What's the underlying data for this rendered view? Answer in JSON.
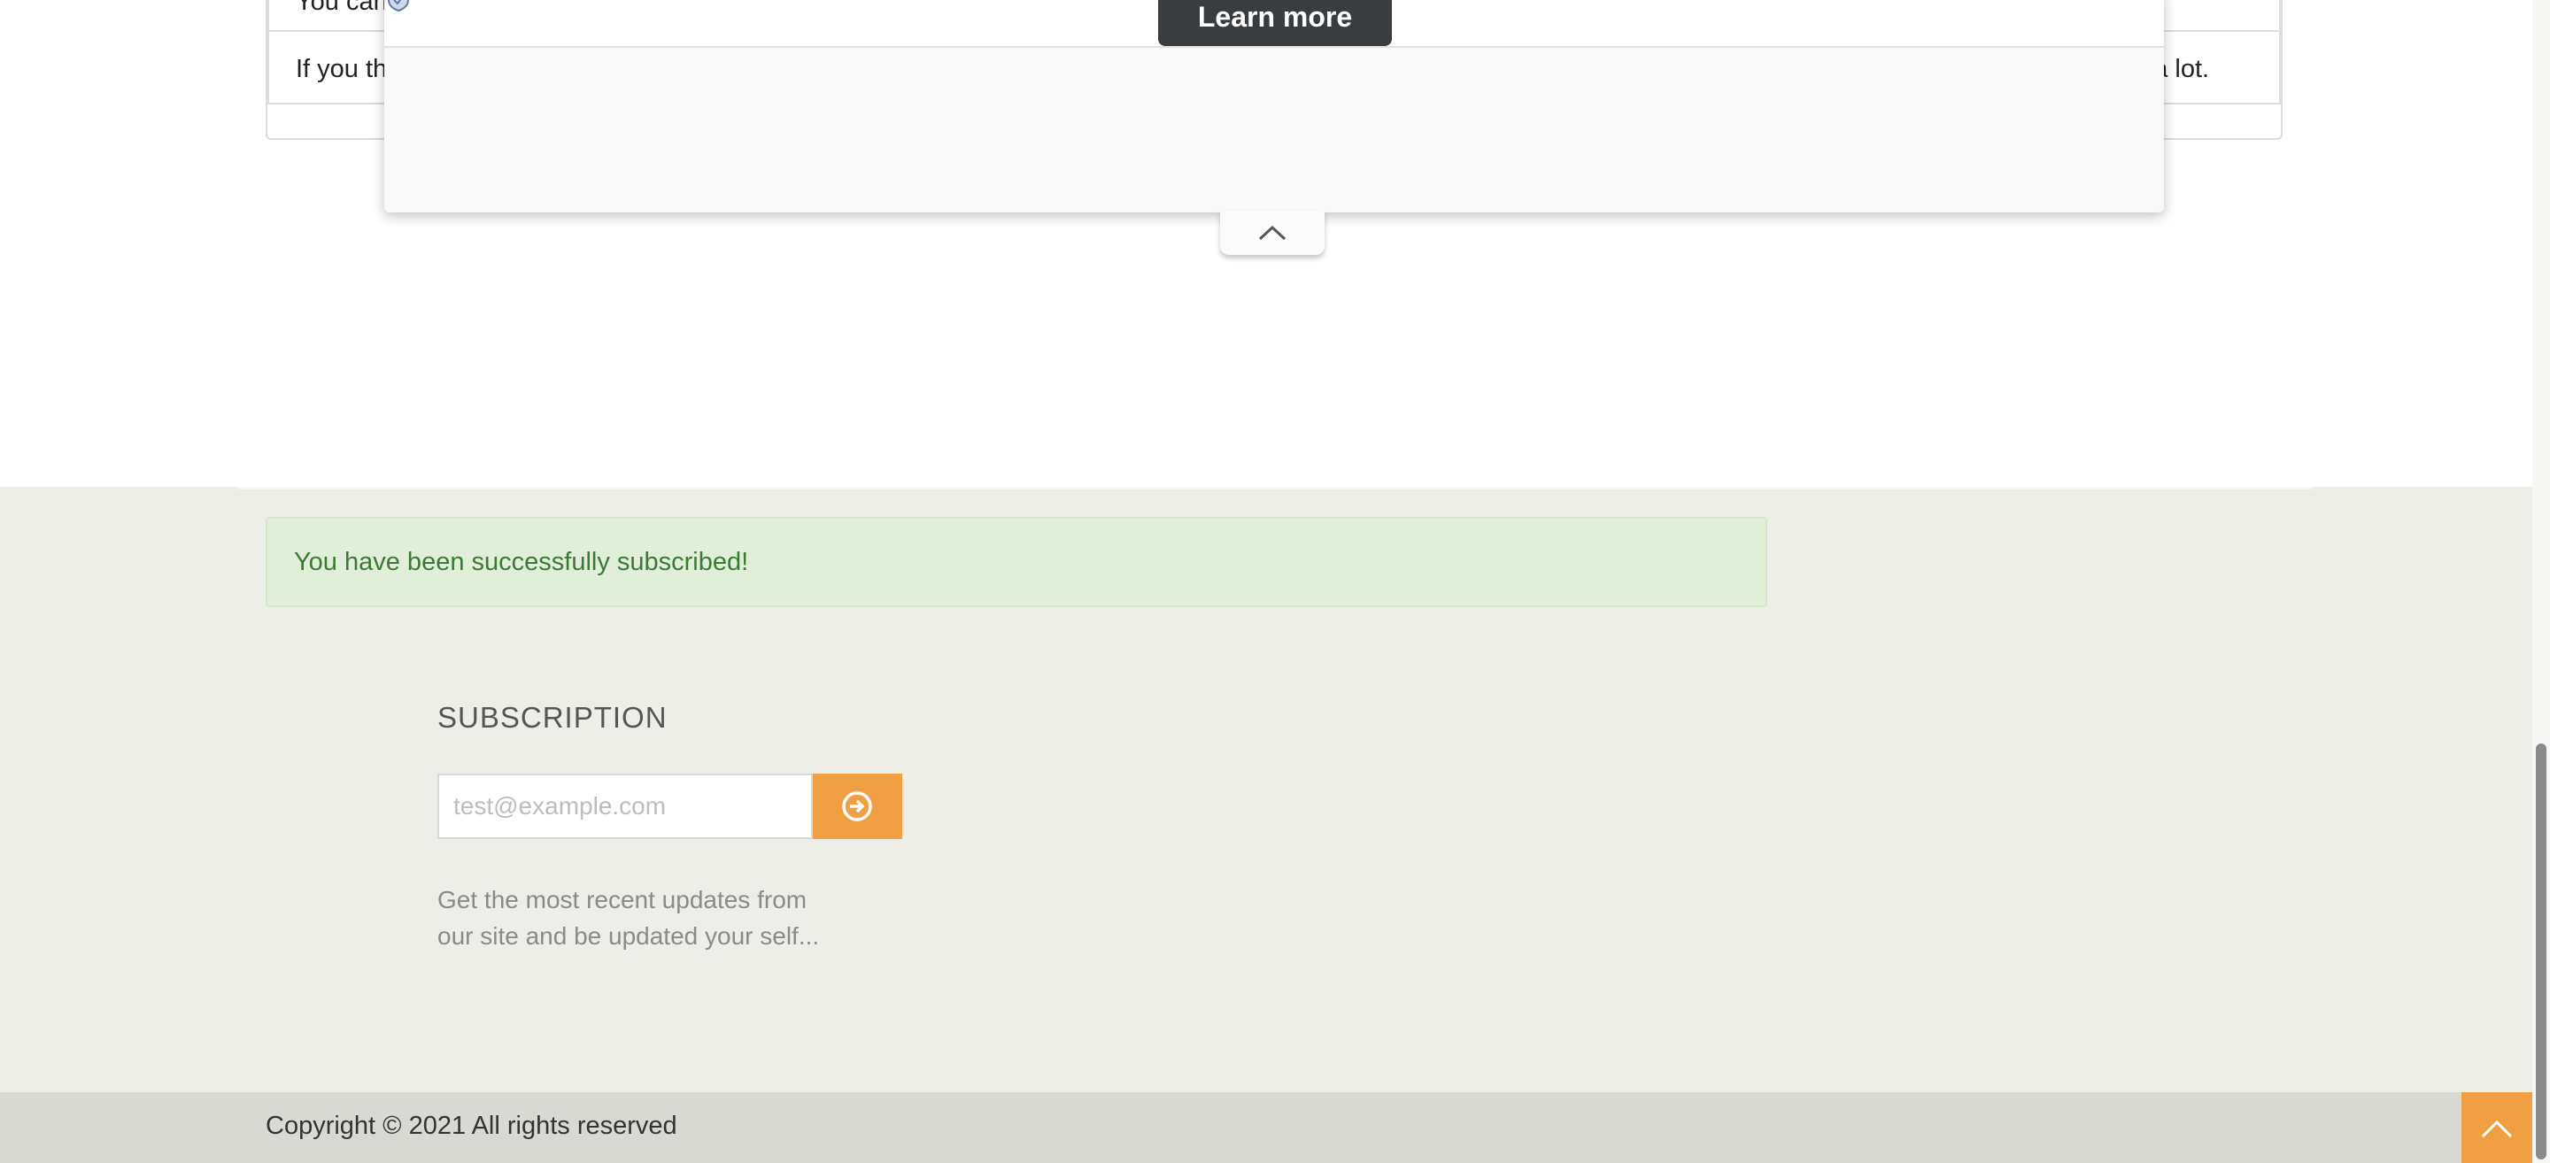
{
  "content_panel": {
    "row1_text": "You can",
    "row2_text_left": "If you th",
    "row2_text_right": "rs a lot."
  },
  "overlay": {
    "learn_more_label": "Learn more",
    "shield_icon": "shield-icon",
    "collapse_icon": "chevron-up-icon"
  },
  "alert": {
    "message": "You have been successfully subscribed!",
    "color": "#3c7a34",
    "background": "#e1efda"
  },
  "subscription": {
    "heading": "SUBSCRIPTION",
    "email_placeholder": "test@example.com",
    "email_value": "",
    "submit_icon": "arrow-circle-right-icon",
    "description_line1": "Get the most recent updates from",
    "description_line2": "our site and be updated your self..."
  },
  "footer": {
    "copyright": "Copyright © 2021 All rights reserved",
    "back_to_top_icon": "chevron-up-icon"
  },
  "colors": {
    "accent": "#f0a043",
    "footer_bg": "#eeeee8",
    "copyright_bg": "#d9d9d3",
    "learn_more_bg": "#3a3d40"
  }
}
